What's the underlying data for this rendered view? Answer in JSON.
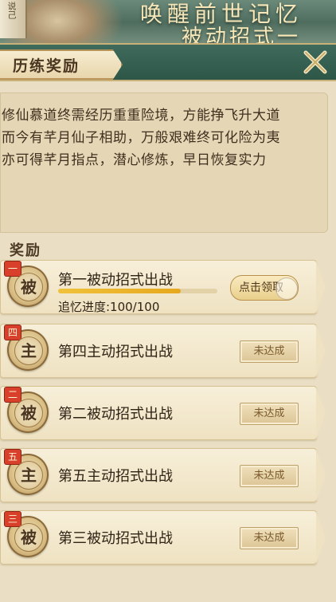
{
  "banner": {
    "scroll_text": "说己",
    "title_line1": "唤醒前世记忆",
    "title_line2": "被动招式一"
  },
  "panel": {
    "title": "历练奖励",
    "close_icon": "close-x-icon"
  },
  "description": {
    "lines": [
      "修仙慕道终需经历重重险境，方能挣飞升大道",
      "而今有芊月仙子相助，万般艰难终可化险为夷",
      "亦可得芊月指点，潜心修炼，早日恢复实力"
    ]
  },
  "rewards": {
    "section_label": "奖励",
    "items": [
      {
        "badge": "一",
        "glyph": "被",
        "name": "第一被动招式出战",
        "progress_label": "追忆进度:100/100",
        "progress": 1.0,
        "action": "点击领取",
        "action_type": "claim"
      },
      {
        "badge": "四",
        "glyph": "主",
        "name": "第四主动招式出战",
        "action": "未达成",
        "action_type": "locked"
      },
      {
        "badge": "二",
        "glyph": "被",
        "name": "第二被动招式出战",
        "action": "未达成",
        "action_type": "locked"
      },
      {
        "badge": "五",
        "glyph": "主",
        "name": "第五主动招式出战",
        "action": "未达成",
        "action_type": "locked"
      },
      {
        "badge": "三",
        "glyph": "被",
        "name": "第三被动招式出战",
        "action": "未达成",
        "action_type": "locked"
      }
    ]
  },
  "colors": {
    "header_green": "#2d5647",
    "gold": "#c9b27a",
    "badge_red": "#d8402c",
    "progress_yellow": "#f0c23b"
  }
}
